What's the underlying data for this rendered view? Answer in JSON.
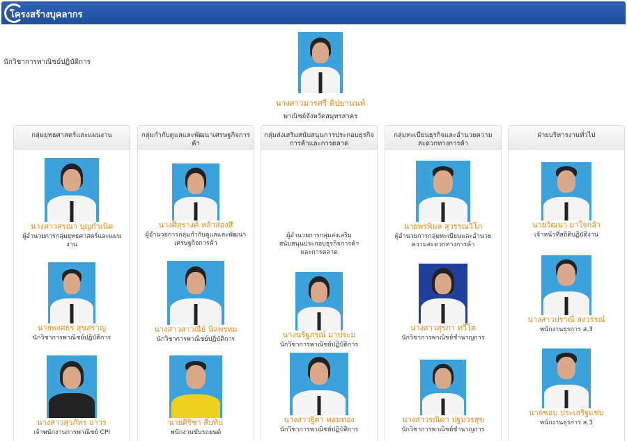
{
  "header": {
    "title": "โครงสร้างบุคลากร"
  },
  "director": {
    "role": "นักวิชาการพาณิชย์ปฏิบัติการ",
    "name": "นางสาวมารศรี ดิปยานนท์",
    "title": "พาณิชย์จังหวัดสมุทรสาคร"
  },
  "columns": [
    {
      "heading": "กลุ่มยุทธศาสตร์และแผนงาน",
      "people": [
        {
          "name": "นางสาวสรณา บุญกำเนิด",
          "title": "ผู้อำนวยการกลุ่มยุทธศาสตร์และแผนงาน"
        },
        {
          "name": "นายพงศธร สุขสราญ",
          "title": "นักวิชาการพาณิชย์ปฏิบัติการ"
        },
        {
          "name": "นางสาวสุวภัทร อาวร",
          "title": "เจ้าพนักงานการพาณิชย์ CPI"
        }
      ]
    },
    {
      "heading": "กลุ่มกำกับดูแลและพัฒนาเศรษฐกิจการค้า",
      "people": [
        {
          "name": "นางศิสุรางค์ หล้าส่องสี",
          "title": "ผู้อำนวยการกลุ่มกำกับดูแลและพัฒนาเศรษฐกิจการค้า"
        },
        {
          "name": "นางสาวสาวณีย์ นิลพรหม",
          "title": "นักวิชาการพาณิชย์ปฏิบัติการ"
        },
        {
          "name": "นายศิริชา สืบทับ",
          "title": "พนักงานขับรถยนต์"
        }
      ]
    },
    {
      "heading": "กลุ่มส่งเสริมสนับสนุนการประกอบธุรกิจการค้าและการตลาด",
      "vacant_title": "ผู้อำนวยการกลุ่มส่งเสริมสนับสนุนประกอบธุรกิจการค้าและการตลาด",
      "people": [
        {
          "name": "นางนรัฐภรณ์ มาประม",
          "title": "นักวิชาการพาณิชย์ปฏิบัติการ"
        },
        {
          "name": "นางสาวฐิตา หอมทอง",
          "title": "นักวิชาการพาณิชย์ปฏิบัติการ"
        }
      ]
    },
    {
      "heading": "กลุ่มทะเบียนธุรกิจและอำนวยความสะดวกทางการค้า",
      "people": [
        {
          "name": "นายพรพิมล สุวรรณวิโภ",
          "title": "ผู้อำนวยการกลุ่มทะเบียนและอำนวยความสะดวกทางการค้า"
        },
        {
          "name": "นางสาวสุรภา ทวีโต",
          "title": "นักวิชาการพาณิชย์ชำนาญการ"
        },
        {
          "name": "นางสาวรณิดา ปฐมวรสุข",
          "title": "นักวิชาการพาณิชย์ชำนาญการ"
        }
      ]
    },
    {
      "heading": "ฝ่ายบริหารงานทั่วไป",
      "people": [
        {
          "name": "นายวัฒนา มาใจกล้า",
          "title": "เจ้าหน้าที่สถิติปฏิบัติงาน"
        },
        {
          "name": "นางสาวปราณี สงวรรณ์",
          "title": "พนักงานธุรการ ส.3"
        },
        {
          "name": "นายชอบ ประเสริฐแช่ม",
          "title": "พนักงานธุรการ ส.3"
        }
      ]
    }
  ]
}
